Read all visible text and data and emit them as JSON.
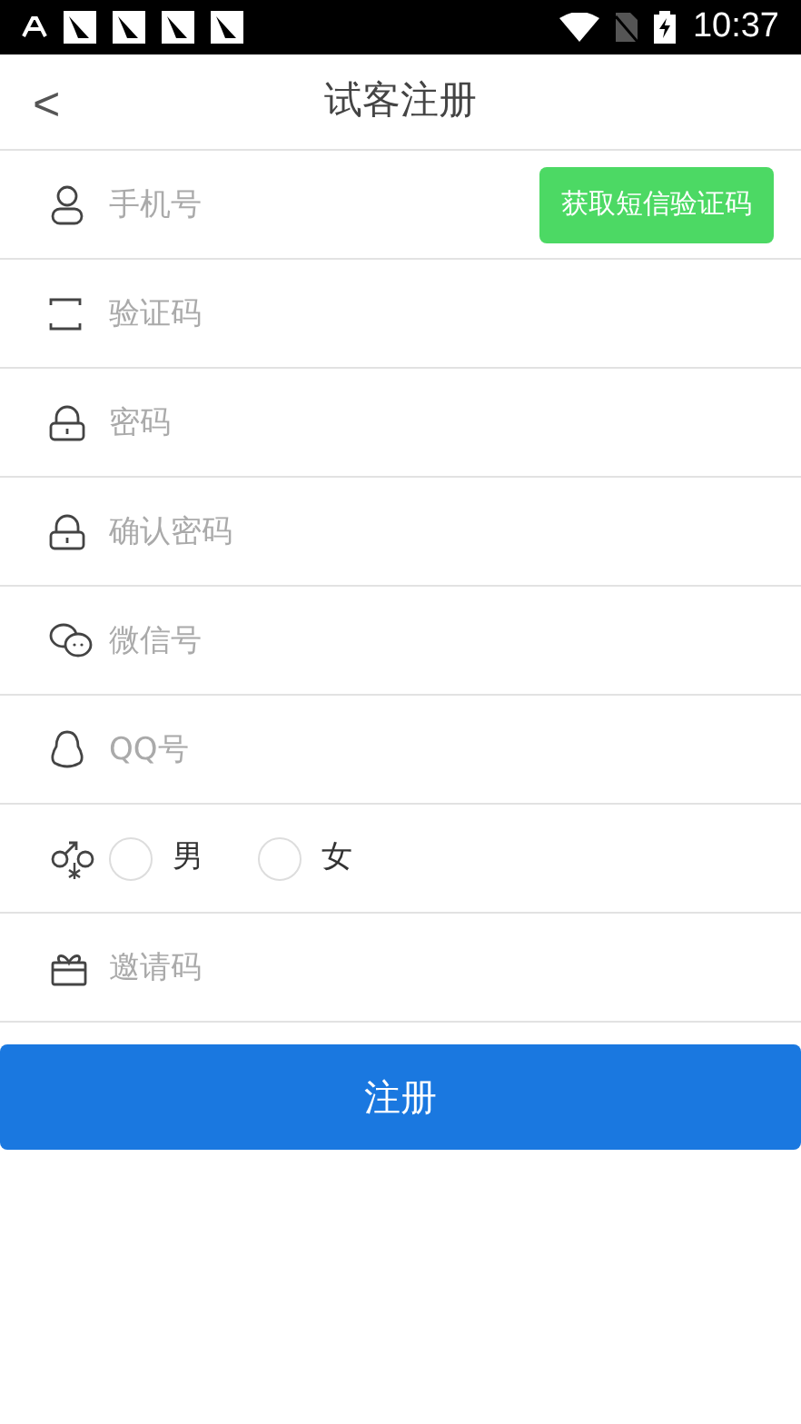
{
  "status_bar": {
    "time": "10:37"
  },
  "header": {
    "back": "<",
    "title": "试客注册"
  },
  "fields": [
    {
      "kind": "input",
      "placeholder": "手机号",
      "action": "获取短信验证码"
    },
    {
      "kind": "input",
      "placeholder": "验证码"
    },
    {
      "kind": "input",
      "placeholder": "密码"
    },
    {
      "kind": "input",
      "placeholder": "确认密码"
    },
    {
      "kind": "input",
      "placeholder": "微信号"
    },
    {
      "kind": "input",
      "placeholder": "QQ号"
    },
    {
      "kind": "gender",
      "options": [
        {
          "label": "男",
          "selected": false
        },
        {
          "label": "女",
          "selected": false
        }
      ]
    },
    {
      "kind": "input",
      "placeholder": "邀请码"
    }
  ],
  "submit": "注册"
}
